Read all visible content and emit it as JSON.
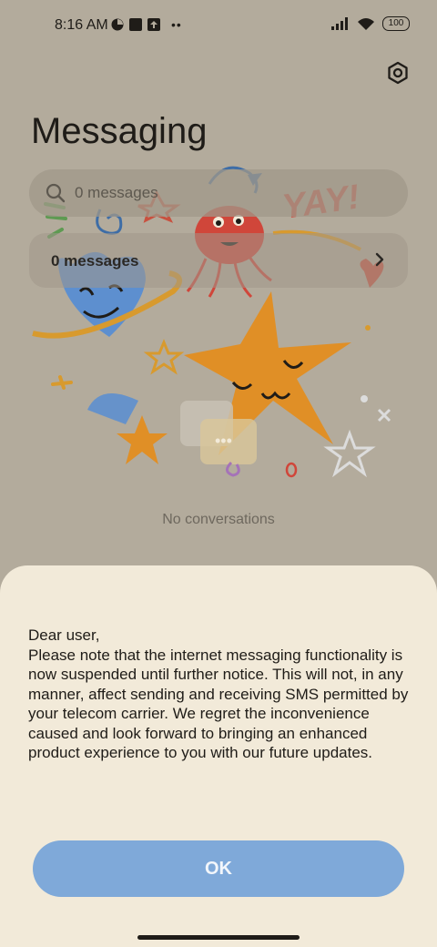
{
  "status_bar": {
    "time": "8:16 AM",
    "battery": "100"
  },
  "header": {
    "title": "Messaging"
  },
  "search": {
    "placeholder": "0 messages"
  },
  "messages_row": {
    "label": "0 messages"
  },
  "empty_state": "No conversations",
  "dialog": {
    "message": "Dear user,\nPlease note that the internet messaging functionality is now suspended until further notice. This will not, in any manner, affect sending and receiving SMS permitted by your telecom carrier. We regret the inconvenience caused and look forward to bringing an enhanced product experience to you with our future updates.",
    "ok_label": "OK"
  },
  "icons": [
    "settings-icon",
    "search-icon",
    "chevron-right-icon",
    "signal-icon",
    "wifi-icon",
    "battery-icon"
  ],
  "colors": {
    "scrim": "#b3ab9c",
    "sheet": "#f2ead9",
    "ok_button": "#7fa9d9"
  }
}
